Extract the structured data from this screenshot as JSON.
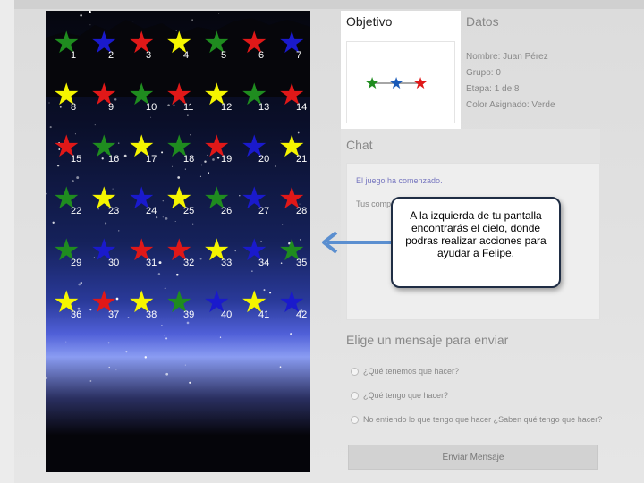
{
  "stars": [
    {
      "n": "1",
      "color": "#1f8c1f"
    },
    {
      "n": "2",
      "color": "#1a1acc"
    },
    {
      "n": "3",
      "color": "#e01818"
    },
    {
      "n": "4",
      "color": "#f5f500"
    },
    {
      "n": "5",
      "color": "#1f8c1f"
    },
    {
      "n": "6",
      "color": "#e01818"
    },
    {
      "n": "7",
      "color": "#1a1acc"
    },
    {
      "n": "8",
      "color": "#f5f500"
    },
    {
      "n": "9",
      "color": "#e01818"
    },
    {
      "n": "10",
      "color": "#1f8c1f"
    },
    {
      "n": "11",
      "color": "#e01818"
    },
    {
      "n": "12",
      "color": "#f5f500"
    },
    {
      "n": "13",
      "color": "#1f8c1f"
    },
    {
      "n": "14",
      "color": "#e01818"
    },
    {
      "n": "15",
      "color": "#e01818"
    },
    {
      "n": "16",
      "color": "#1f8c1f"
    },
    {
      "n": "17",
      "color": "#f5f500"
    },
    {
      "n": "18",
      "color": "#1f8c1f"
    },
    {
      "n": "19",
      "color": "#e01818"
    },
    {
      "n": "20",
      "color": "#1a1acc"
    },
    {
      "n": "21",
      "color": "#f5f500"
    },
    {
      "n": "22",
      "color": "#1f8c1f"
    },
    {
      "n": "23",
      "color": "#f5f500"
    },
    {
      "n": "24",
      "color": "#1a1acc"
    },
    {
      "n": "25",
      "color": "#f5f500"
    },
    {
      "n": "26",
      "color": "#1f8c1f"
    },
    {
      "n": "27",
      "color": "#1a1acc"
    },
    {
      "n": "28",
      "color": "#e01818"
    },
    {
      "n": "29",
      "color": "#1f8c1f"
    },
    {
      "n": "30",
      "color": "#1a1acc"
    },
    {
      "n": "31",
      "color": "#e01818"
    },
    {
      "n": "32",
      "color": "#e01818"
    },
    {
      "n": "33",
      "color": "#f5f500"
    },
    {
      "n": "34",
      "color": "#1a1acc"
    },
    {
      "n": "35",
      "color": "#1f8c1f"
    },
    {
      "n": "36",
      "color": "#f5f500"
    },
    {
      "n": "37",
      "color": "#e01818"
    },
    {
      "n": "38",
      "color": "#f5f500"
    },
    {
      "n": "39",
      "color": "#1f8c1f"
    },
    {
      "n": "40",
      "color": "#1a1acc"
    },
    {
      "n": "41",
      "color": "#f5f500"
    },
    {
      "n": "42",
      "color": "#1a1acc"
    }
  ],
  "objetivo": {
    "title": "Objetivo",
    "target_colors": [
      "#1f8c1f",
      "#1a5ab8",
      "#e01818"
    ]
  },
  "datos": {
    "title": "Datos",
    "nombre": "Nombre: Juan Pérez",
    "grupo": "Grupo: 0",
    "etapa": "Etapa: 1 de 8",
    "color": "Color Asignado: Verde"
  },
  "chat": {
    "title": "Chat",
    "msg1": "El juego ha comenzado.",
    "msg2": "Tus compa"
  },
  "mensajes": {
    "title": "Elige un mensaje para enviar",
    "options": [
      "¿Qué tenemos que hacer?",
      "¿Qué tengo que hacer?",
      "No entiendo lo que tengo que hacer ¿Saben qué tengo que hacer?"
    ],
    "send_label": "Enviar Mensaje"
  },
  "callout": {
    "text": "A la izquierda de tu pantalla encontrarás el cielo, donde podras realizar acciones para ayudar a Felipe."
  }
}
